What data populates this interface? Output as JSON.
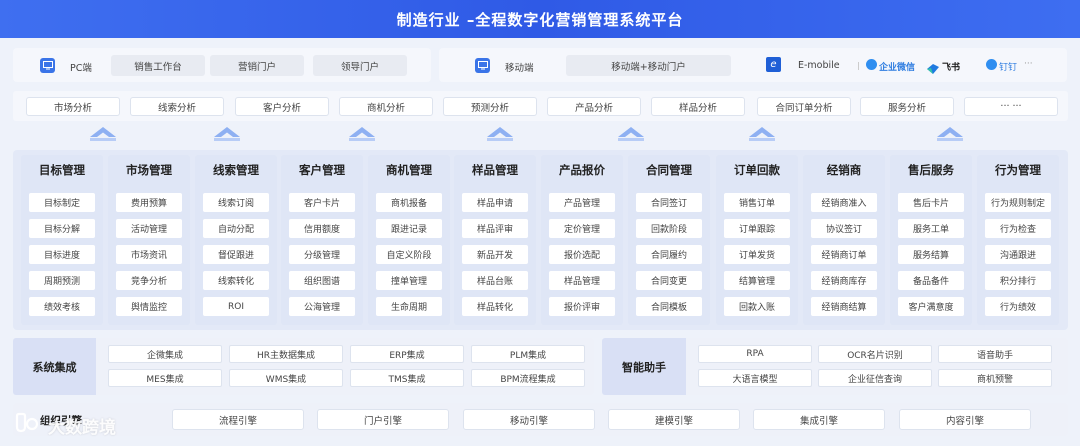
{
  "title": "制造行业 –全程数字化营销管理系统平台",
  "platforms": {
    "pc_label": "PC端",
    "pc_chips": [
      "销售工作台",
      "营销门户",
      "领导门户"
    ],
    "mobile_label": "移动端",
    "mobile_chip": "移动端+移动门户",
    "emobile_label": "E-mobile",
    "qiwei_label": "企业微信",
    "feishu_label": "飞书",
    "dingding_label": "钉钉",
    "more": "···"
  },
  "tabs": [
    "市场分析",
    "线索分析",
    "客户分析",
    "商机分析",
    "预测分析",
    "产品分析",
    "样品分析",
    "合同订单分析",
    "服务分析",
    "··· ···"
  ],
  "modules": [
    {
      "title": "目标管理",
      "items": [
        "目标制定",
        "目标分解",
        "目标进度",
        "周期预测",
        "绩效考核"
      ]
    },
    {
      "title": "市场管理",
      "items": [
        "费用预算",
        "活动管理",
        "市场资讯",
        "竞争分析",
        "舆情监控"
      ]
    },
    {
      "title": "线索管理",
      "items": [
        "线索订阅",
        "自动分配",
        "督促跟进",
        "线索转化",
        "ROI"
      ]
    },
    {
      "title": "客户管理",
      "items": [
        "客户卡片",
        "信用额度",
        "分级管理",
        "组织图谱",
        "公海管理"
      ]
    },
    {
      "title": "商机管理",
      "items": [
        "商机报备",
        "跟进记录",
        "自定义阶段",
        "撞单管理",
        "生命周期"
      ]
    },
    {
      "title": "样品管理",
      "items": [
        "样品申请",
        "样品评审",
        "新品开发",
        "样品台账",
        "样品转化"
      ]
    },
    {
      "title": "产品报价",
      "items": [
        "产品管理",
        "定价管理",
        "报价选配",
        "样品管理",
        "报价评审"
      ]
    },
    {
      "title": "合同管理",
      "items": [
        "合同签订",
        "回款阶段",
        "合同履约",
        "合同变更",
        "合同模板"
      ]
    },
    {
      "title": "订单回款",
      "items": [
        "销售订单",
        "订单跟踪",
        "订单发货",
        "结算管理",
        "回款入账"
      ]
    },
    {
      "title": "经销商",
      "items": [
        "经销商准入",
        "协议签订",
        "经销商订单",
        "经销商库存",
        "经销商结算"
      ]
    },
    {
      "title": "售后服务",
      "items": [
        "售后卡片",
        "服务工单",
        "服务结算",
        "备品备件",
        "客户满意度"
      ]
    },
    {
      "title": "行为管理",
      "items": [
        "行为规则制定",
        "行为检查",
        "沟通跟进",
        "积分排行",
        "行为绩效"
      ]
    }
  ],
  "integration": {
    "title": "系统集成",
    "items": [
      "企微集成",
      "HR主数据集成",
      "ERP集成",
      "PLM集成",
      "MES集成",
      "WMS集成",
      "TMS集成",
      "BPM流程集成"
    ]
  },
  "assistant": {
    "title": "智能助手",
    "items": [
      "RPA",
      "OCR名片识别",
      "语音助手",
      "大语言模型",
      "企业征信查询",
      "商机预警"
    ]
  },
  "engines": {
    "title": "组织引擎",
    "items": [
      "流程引擎",
      "门户引擎",
      "移动引擎",
      "建模引擎",
      "集成引擎",
      "内容引擎"
    ]
  },
  "watermark": "大数跨境",
  "colors": {
    "accent": "#3f6ff0",
    "module_bg": "#e3e9f7",
    "arrow": "#9fbcf3"
  }
}
